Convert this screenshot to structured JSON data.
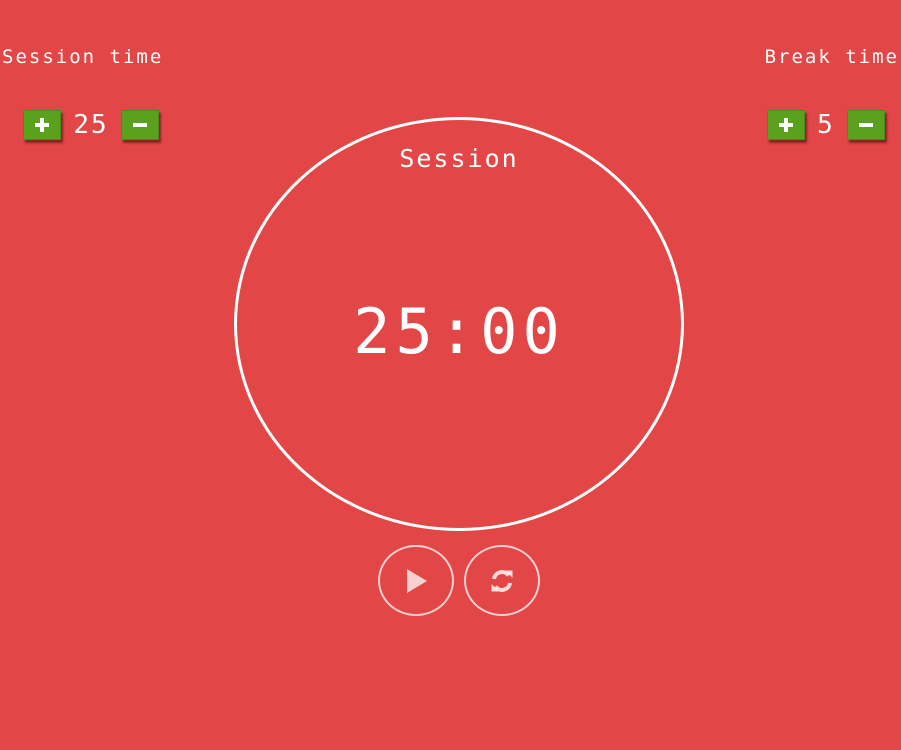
{
  "session_time": {
    "label": "Session time",
    "value": "25",
    "increment_icon": "plus-icon",
    "decrement_icon": "minus-icon"
  },
  "break_time": {
    "label": "Break time",
    "value": "5",
    "increment_icon": "plus-icon",
    "decrement_icon": "minus-icon"
  },
  "timer": {
    "mode": "Session",
    "display": "25:00"
  },
  "controls": {
    "play_icon": "play-icon",
    "reset_icon": "refresh-icon"
  },
  "colors": {
    "background": "#e34646",
    "button_green": "#5aa21e",
    "text": "#ffffff"
  }
}
